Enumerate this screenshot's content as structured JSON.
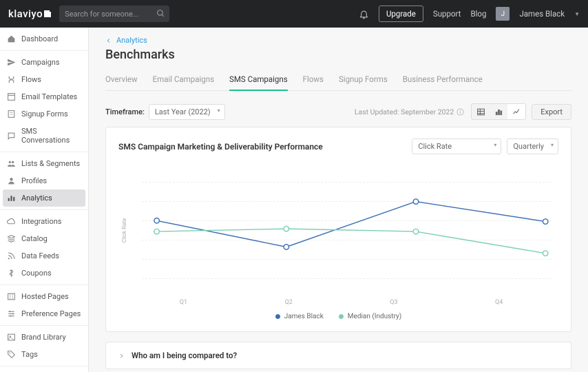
{
  "header": {
    "logo": "klaviyo",
    "search_placeholder": "Search for someone...",
    "upgrade": "Upgrade",
    "support": "Support",
    "blog": "Blog",
    "user_initial": "J",
    "user_name": "James Black"
  },
  "sidebar": {
    "groups": [
      [
        {
          "label": "Dashboard",
          "icon": "home"
        }
      ],
      [
        {
          "label": "Campaigns",
          "icon": "send"
        },
        {
          "label": "Flows",
          "icon": "flow"
        },
        {
          "label": "Email Templates",
          "icon": "template"
        },
        {
          "label": "Signup Forms",
          "icon": "form"
        },
        {
          "label": "SMS Conversations",
          "icon": "chat"
        }
      ],
      [
        {
          "label": "Lists & Segments",
          "icon": "people"
        },
        {
          "label": "Profiles",
          "icon": "person"
        },
        {
          "label": "Analytics",
          "icon": "bars",
          "active": true
        }
      ],
      [
        {
          "label": "Integrations",
          "icon": "cloud"
        },
        {
          "label": "Catalog",
          "icon": "stack"
        },
        {
          "label": "Data Feeds",
          "icon": "feed"
        },
        {
          "label": "Coupons",
          "icon": "dollar"
        }
      ],
      [
        {
          "label": "Hosted Pages",
          "icon": "columns"
        },
        {
          "label": "Preference Pages",
          "icon": "sliders"
        }
      ],
      [
        {
          "label": "Brand Library",
          "icon": "image"
        },
        {
          "label": "Tags",
          "icon": "tag"
        }
      ]
    ]
  },
  "breadcrumb": {
    "parent": "Analytics"
  },
  "page": {
    "title": "Benchmarks"
  },
  "tabs": [
    "Overview",
    "Email Campaigns",
    "SMS Campaigns",
    "Flows",
    "Signup Forms",
    "Business Performance"
  ],
  "active_tab": 2,
  "controls": {
    "timeframe_label": "Timeframe:",
    "timeframe_value": "Last Year (2022)",
    "last_updated": "Last Updated: September 2022",
    "export": "Export"
  },
  "chart_card": {
    "title": "SMS Campaign Marketing & Deliverability Performance",
    "metric_dropdown": "Click Rate",
    "interval_dropdown": "Quarterly",
    "ylabel": "Click Rate",
    "legend": [
      {
        "name": "James Black",
        "color": "#3b6fb5"
      },
      {
        "name": "Median (Industry)",
        "color": "#7bcfb5"
      }
    ]
  },
  "chart_data": {
    "type": "line",
    "categories": [
      "Q1",
      "Q2",
      "Q3",
      "Q4"
    ],
    "series": [
      {
        "name": "James Black",
        "color": "#3b6fb5",
        "values": [
          64,
          35,
          85,
          63
        ]
      },
      {
        "name": "Median (Industry)",
        "color": "#7bcfb5",
        "values": [
          52,
          55,
          52,
          28
        ]
      }
    ],
    "ylabel": "Click Rate"
  },
  "accordion": {
    "title": "Who am I being compared to?"
  }
}
